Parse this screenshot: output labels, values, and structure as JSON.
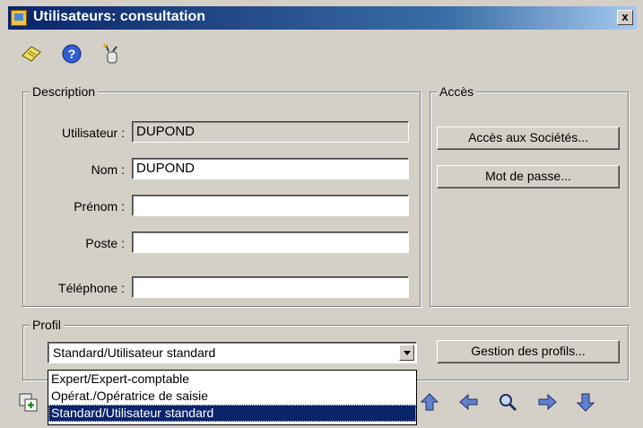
{
  "window": {
    "title": "Utilisateurs: consultation",
    "close_glyph": "x"
  },
  "toolbar": {
    "icons": [
      "notepad-icon",
      "help-icon",
      "wizard-icon"
    ]
  },
  "description": {
    "legend": "Description",
    "utilisateur_label": "Utilisateur :",
    "utilisateur_value": "DUPOND",
    "nom_label": "Nom :",
    "nom_value": "DUPOND",
    "prenom_label": "Prénom :",
    "prenom_value": "",
    "poste_label": "Poste :",
    "poste_value": "",
    "telephone_label": "Téléphone :",
    "telephone_value": ""
  },
  "acces": {
    "legend": "Accès",
    "societes_button": "Accès aux Sociétés...",
    "password_button": "Mot de passe..."
  },
  "profil": {
    "legend": "Profil",
    "selected": "Standard/Utilisateur standard",
    "manage_button": "Gestion des profils...",
    "options": [
      "Expert/Expert-comptable",
      "Opérat./Opératrice de saisie",
      "Standard/Utilisateur standard"
    ]
  },
  "nav": {
    "icons": [
      "new-record-icon",
      "up-arrow-icon",
      "left-arrow-icon",
      "search-icon",
      "right-arrow-icon",
      "down-arrow-icon"
    ]
  },
  "colors": {
    "titlebar": "#0a246a",
    "selection": "#0a246a",
    "face": "#d4d0c8"
  }
}
